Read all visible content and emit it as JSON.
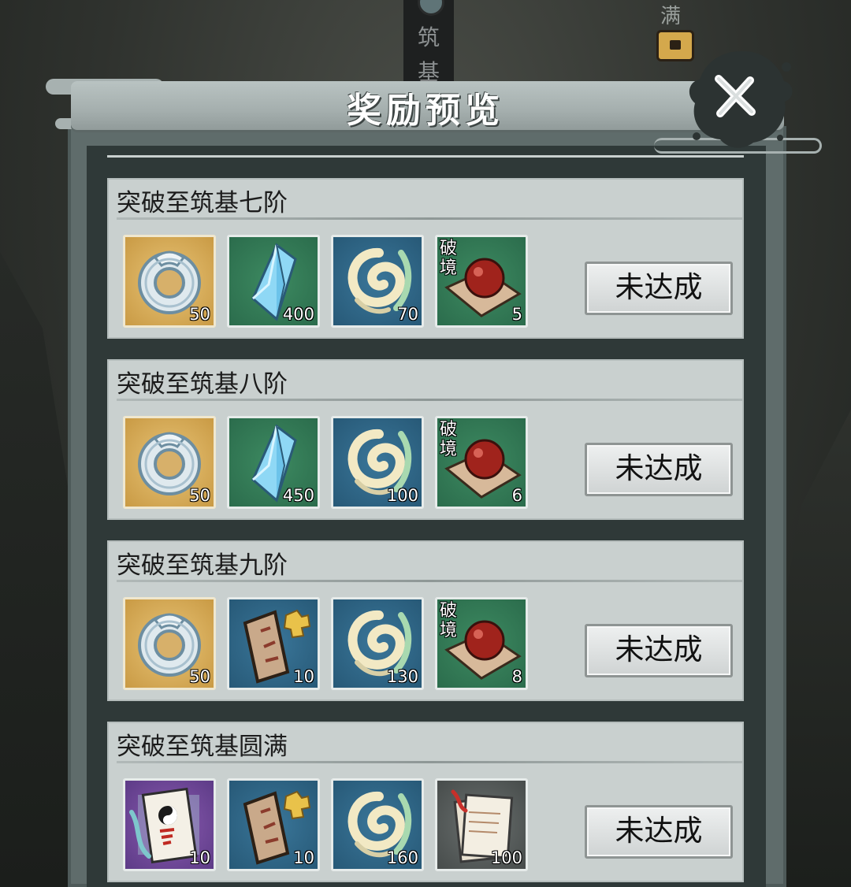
{
  "background": {
    "banner_text": "筑基",
    "corner_text": "满"
  },
  "dialog": {
    "title": "奖励预览",
    "close_icon": "close-x-icon"
  },
  "tiers": [
    {
      "label": "突破至筑基七阶",
      "status": "未达成",
      "rewards": [
        {
          "icon": "jade-ring-icon",
          "rarity": "gold",
          "count": "50"
        },
        {
          "icon": "crystal-icon",
          "rarity": "green",
          "count": "400"
        },
        {
          "icon": "spirit-swirl-icon",
          "rarity": "blue",
          "count": "70"
        },
        {
          "icon": "breakthrough-pill-icon",
          "rarity": "green",
          "tag": "破境",
          "count": "5"
        }
      ]
    },
    {
      "label": "突破至筑基八阶",
      "status": "未达成",
      "rewards": [
        {
          "icon": "jade-ring-icon",
          "rarity": "gold",
          "count": "50"
        },
        {
          "icon": "crystal-icon",
          "rarity": "green",
          "count": "450"
        },
        {
          "icon": "spirit-swirl-icon",
          "rarity": "blue",
          "count": "100"
        },
        {
          "icon": "breakthrough-pill-icon",
          "rarity": "green",
          "tag": "破境",
          "count": "6"
        }
      ]
    },
    {
      "label": "突破至筑基九阶",
      "status": "未达成",
      "rewards": [
        {
          "icon": "jade-ring-icon",
          "rarity": "gold",
          "count": "50"
        },
        {
          "icon": "scroll-fragment-icon",
          "rarity": "blue",
          "count": "10"
        },
        {
          "icon": "spirit-swirl-icon",
          "rarity": "blue",
          "count": "130"
        },
        {
          "icon": "breakthrough-pill-icon",
          "rarity": "green",
          "tag": "破境",
          "count": "8"
        }
      ]
    },
    {
      "label": "突破至筑基圆满",
      "status": "未达成",
      "rewards": [
        {
          "icon": "taiji-talisman-icon",
          "rarity": "purple",
          "count": "10"
        },
        {
          "icon": "scroll-fragment-icon",
          "rarity": "blue",
          "count": "10"
        },
        {
          "icon": "spirit-swirl-icon",
          "rarity": "blue",
          "count": "160"
        },
        {
          "icon": "paper-notes-icon",
          "rarity": "grey",
          "count": "100"
        }
      ]
    }
  ]
}
